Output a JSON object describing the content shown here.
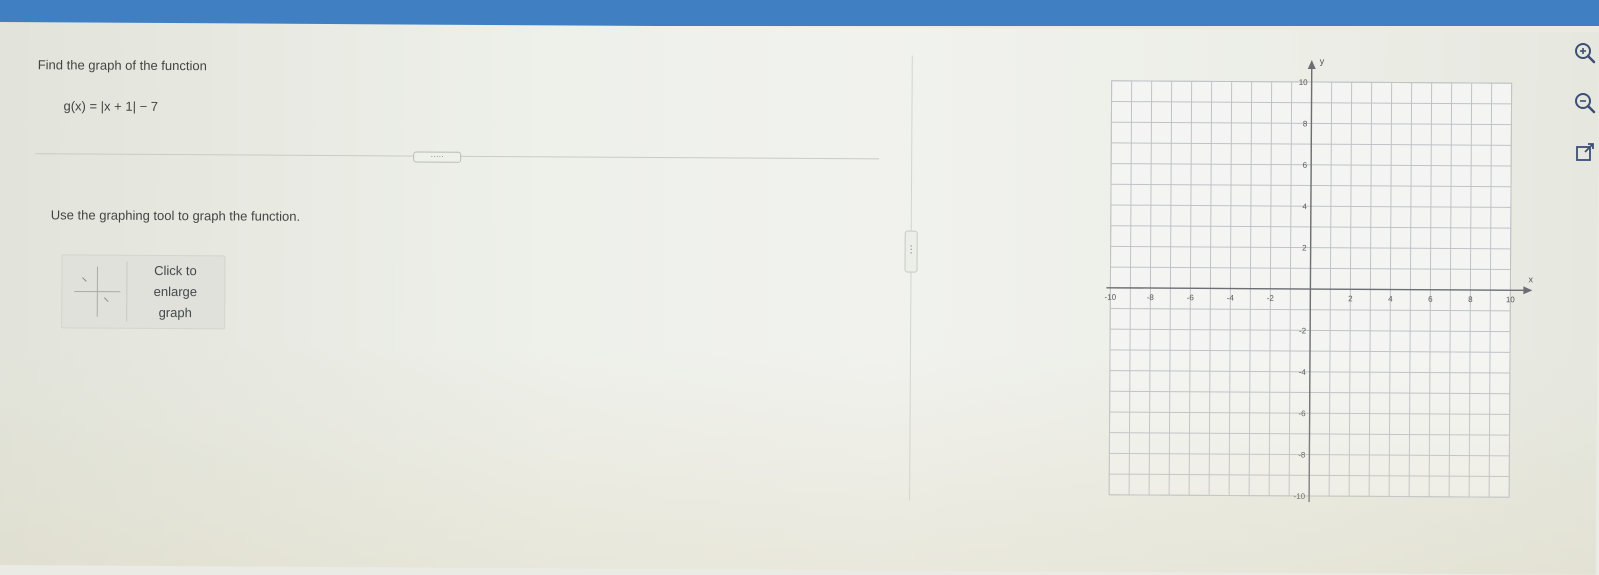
{
  "question": {
    "prompt": "Find the graph of the function",
    "function_text": "g(x) = |x + 1| − 7",
    "more_label": "·····",
    "instruction": "Use the graphing tool to graph the function."
  },
  "enlarge_button": {
    "line1": "Click to",
    "line2": "enlarge",
    "line3": "graph"
  },
  "panel_handle_label": "⋮",
  "tools": {
    "icons": [
      "zoom-in-icon",
      "zoom-out-icon",
      "popout-icon"
    ]
  },
  "colors": {
    "top_bar": "#3f7fc2",
    "grid": "#bfc3c8",
    "axis": "#6b6e72"
  },
  "chart_data": {
    "type": "line",
    "xlabel": "x",
    "ylabel": "y",
    "xlim": [
      -10,
      10
    ],
    "ylim": [
      -10,
      10
    ],
    "grid": true,
    "x_ticks": [
      "-10",
      "-8",
      "-6",
      "-4",
      "-2",
      "2",
      "4",
      "6",
      "8",
      "10"
    ],
    "y_ticks": [
      "10",
      "8",
      "6",
      "4",
      "2",
      "-2",
      "-4",
      "-6",
      "-8",
      "-10"
    ],
    "series": []
  }
}
